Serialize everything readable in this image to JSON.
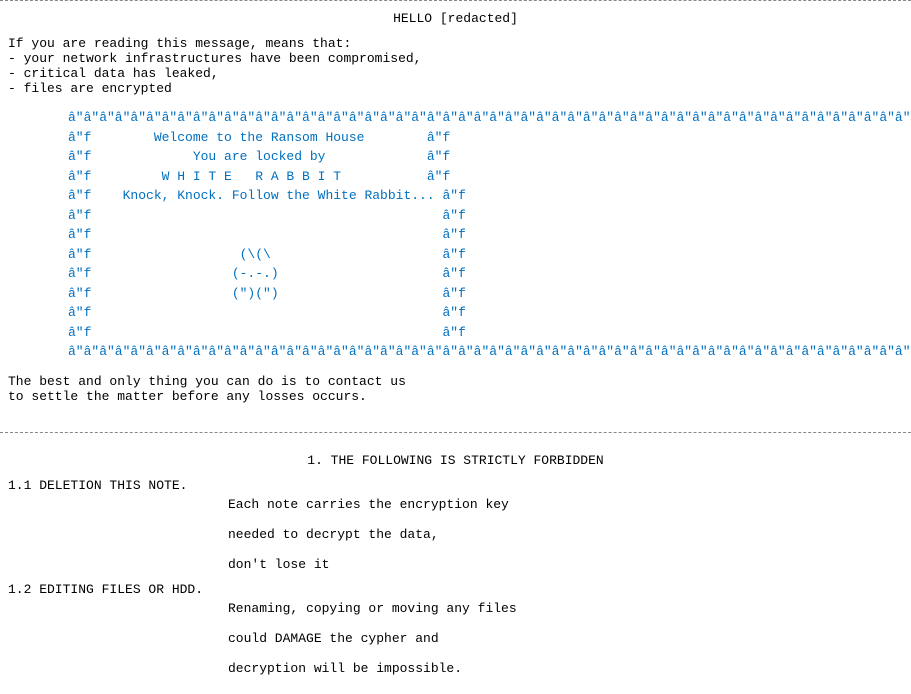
{
  "page": {
    "dashed_border_top": "- - - - - - - - -",
    "hello_line": "HELLO [redacted]",
    "intro": {
      "line1": "If you are reading this message, means that:",
      "line2": "    - your network infrastructures have been compromised,",
      "line3": "    - critical data has leaked,",
      "line4": "    - files are encrypted"
    },
    "ascii_art": {
      "border_top": "â\"â\"â\"â\"â\"â\"â\"â\"â\"â\"â\"â\"â\"â\"â\"â\"â\"â\"â\"â\"â\"â\"â\"â\"â\"â\"â\"â\"â\"â\"â\"â\"â\"â\"â\"â\"â\"â\"â\"â\"â\"â\"â\"â\"â\"â\"â\"â\"â\"â\"\"",
      "welcome": "â\"f        Welcome to the Ransom House         â\"f",
      "locked": "â\"f             You are locked by             â\"f",
      "white_rabbit": "â\"f         W H I T E   R A B B I T          â\"f",
      "knock": "â\"f      Knock, Knock. Follow the White Rabbit... â\"f",
      "empty1": "â\"f                                             â\"f",
      "empty2": "â\"f                                             â\"f",
      "bunny1": "â\"f                    (\\(\\                     â\"f",
      "bunny2": "â\"f                   (-.-.)                    â\"f",
      "bunny3": "â\"f                   (\")(\")'                   â\"f",
      "empty3": "â\"f                                             â\"f",
      "empty4": "â\"f                                             â\"f",
      "border_bottom": "â\"_â\"â\"â\"â\"â\"â\"â\"â\"â\"â\"â\"â\"â\"â\"â\"â\"â\"â\"â\"â\"â\"â\"â\"â\"â\"â\"â\"â\"â\"â\"â\"â\"â\"â\"â\"â\"â\"â\"â\"â\"â\"â\"â\"â\"â\"â\"â\"â\"â\","
    },
    "contact_text": {
      "line1": "The best and only thing you can do is to contact us",
      "line2": "  to settle the matter before any losses occurs."
    },
    "section1_title": "1. THE FOLLOWING IS STRICTLY FORBIDDEN",
    "rule_1_1": {
      "header": "1.1 DELETION THIS NOTE.",
      "body_line1": "Each note carries the encryption key",
      "body_line2": "needed to decrypt the data,",
      "body_line3": "don't lose it"
    },
    "rule_1_2": {
      "header": "1.2 EDITING FILES OR HDD.",
      "body_line1": "Renaming, copying or moving any files",
      "body_line2": "could DAMAGE the cypher and",
      "body_line3": "decryption will be impossible."
    }
  }
}
